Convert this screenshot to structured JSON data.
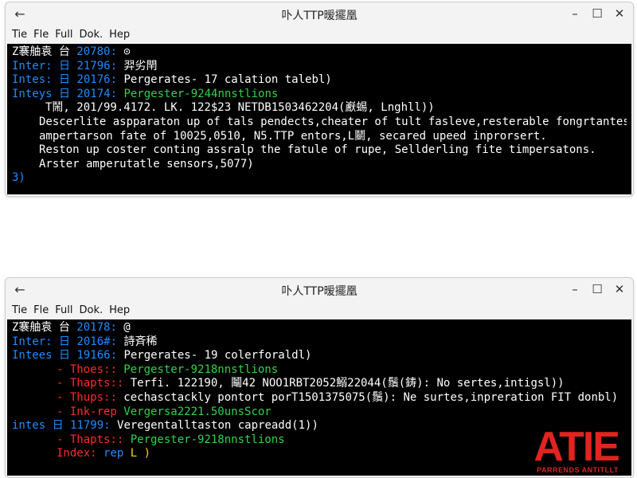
{
  "colors": {
    "prompt_blue": "#1e8cff",
    "green": "#2fd34a",
    "red": "#ff2a2a",
    "yellow": "#ffd21a",
    "logo_red": "#e0241f"
  },
  "windows": [
    {
      "title": "卟人TTP暧擺凰",
      "menu": [
        "Tie",
        "Fle",
        "Full",
        "Dok.",
        "Hep"
      ],
      "lines": [
        {
          "prefix": "Z褰舳袁 台 ",
          "num": "20780:",
          "rest": " ⊙"
        },
        {
          "prefix": "Inter: 日 ",
          "num": "21796:",
          "rest": " 羿劣閈"
        },
        {
          "prefix": "Intes: 日 ",
          "num": "20176:",
          "rest": " Pergerates- 17 calation talebl)"
        },
        {
          "prefix": "Inteys 日 ",
          "num": "20174:",
          "rest": " Pergester-9244nnstlions"
        },
        {
          "text": "T鬧, 201/99.4172. LK. 122$23 NETDB1503462204(巚蜴, Lnghll))"
        },
        {
          "text": "Descerlite aspparaton up of tals pendects,cheater of tult fasleve,resterable fongrtantes,"
        },
        {
          "text": "ampertarson fate of 10025,0510, N5.TTP entors,L鬭, secared upeed inprorsert."
        },
        {
          "text": "Reston up coster conting assralp the fatule of rupe, Sellderling fite timpersatons."
        },
        {
          "text": "Arster amperutatle sensors,5077)"
        },
        {
          "text": "3)"
        }
      ]
    },
    {
      "title": "卟人TTP暧擺凰",
      "menu": [
        "Tie",
        "Fle",
        "Full",
        "Dok.",
        "Hep"
      ],
      "lines": [
        {
          "prefix": "Z褰舳袁 台 ",
          "num": "20178:",
          "rest": " @"
        },
        {
          "prefix": "Inter: 日 ",
          "num": "2016#:",
          "rest": " 詩斉稀"
        },
        {
          "prefix": "Intees 日 ",
          "num": "19166:",
          "rest": " Pergerates- 19 colerforaldl)"
        },
        {
          "label": "- Thoes:",
          "sep": ": ",
          "rest": "Pergester-9218nnstlions"
        },
        {
          "label": "- Thapts:",
          "sep": ": ",
          "rest": "Terfi. 122190, 鬮42 NOO1RBT2052鰯22044(鬚(鋳): No sertes,intigsl))"
        },
        {
          "label": "- Thups:",
          "sep": ": ",
          "rest": "cechasctackly pontort porT1501375075(鬚): Ne surtes,inpreration FIT donbl)"
        },
        {
          "label": "- Ink-rep",
          "sep": " ",
          "rest": "Vergersa2221.50unsScor"
        },
        {
          "prefix": "intes 日 ",
          "num": "11799:",
          "rest": " Veregentalltaston capreadd(1))"
        },
        {
          "label": "- Thapts:",
          "sep": ": ",
          "rest": "Pergester-9218nnstlions"
        },
        {
          "label": "Index:",
          "sep": " ",
          "rest": "rep",
          "cursor": "L )"
        }
      ]
    }
  ],
  "logo": {
    "text": "ATIE",
    "sub": "PARRENDS ANTITLLT"
  }
}
